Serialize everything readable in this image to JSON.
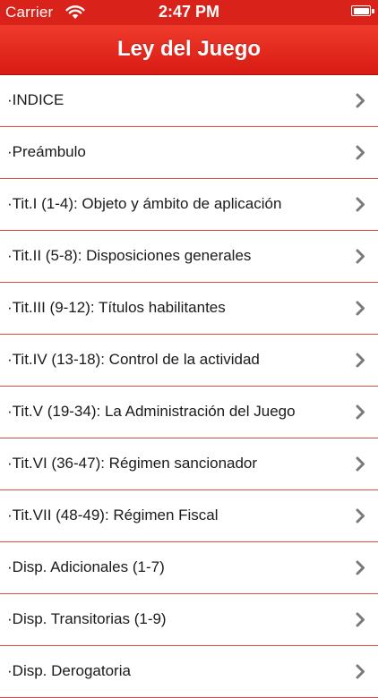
{
  "status_bar": {
    "carrier": "Carrier",
    "time": "2:47 PM",
    "wifi_icon": "wifi-icon",
    "battery_icon": "battery-icon",
    "battery_level": 1.0
  },
  "navigation": {
    "title": "Ley del Juego"
  },
  "list": {
    "chevron_icon": "chevron-right-icon",
    "items": [
      {
        "label": "·INDICE"
      },
      {
        "label": "·Preámbulo"
      },
      {
        "label": "·Tit.I (1-4): Objeto y ámbito de aplicación"
      },
      {
        "label": "·Tit.II (5-8): Disposiciones generales"
      },
      {
        "label": "·Tit.III (9-12): Títulos habilitantes"
      },
      {
        "label": "·Tit.IV (13-18): Control de la actividad"
      },
      {
        "label": "·Tit.V (19-34): La Administración del Juego"
      },
      {
        "label": "·Tit.VI (36-47): Régimen sancionador"
      },
      {
        "label": "·Tit.VII (48-49): Régimen Fiscal"
      },
      {
        "label": "·Disp. Adicionales (1-7)"
      },
      {
        "label": "·Disp. Transitorias (1-9)"
      },
      {
        "label": "·Disp. Derogatoria"
      }
    ]
  },
  "colors": {
    "accent": "#d8221a",
    "separator": "#e04c44",
    "chevron": "#7a7a7a"
  }
}
